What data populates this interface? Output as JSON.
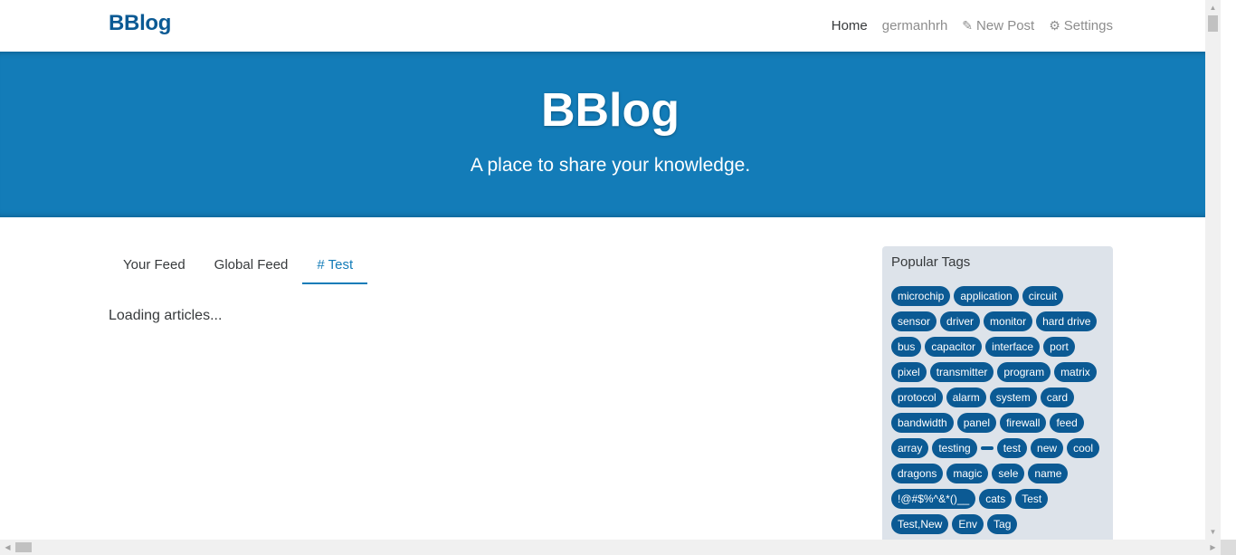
{
  "nav": {
    "brand": "BBlog",
    "links": [
      {
        "label": "Home",
        "icon": ""
      },
      {
        "label": "germanhrh",
        "icon": ""
      },
      {
        "label": "New Post",
        "icon": "✎"
      },
      {
        "label": "Settings",
        "icon": "⚙"
      }
    ]
  },
  "banner": {
    "title": "BBlog",
    "subtitle": "A place to share your knowledge."
  },
  "feed": {
    "tabs": [
      {
        "label": "Your Feed"
      },
      {
        "label": "Global Feed"
      },
      {
        "label": "# Test"
      }
    ],
    "loading_text": "Loading articles..."
  },
  "sidebar": {
    "title": "Popular Tags",
    "tags": [
      "microchip",
      "application",
      "circuit",
      "sensor",
      "driver",
      "monitor",
      "hard drive",
      "bus",
      "capacitor",
      "interface",
      "port",
      "pixel",
      "transmitter",
      "program",
      "matrix",
      "protocol",
      "alarm",
      "system",
      "card",
      "bandwidth",
      "panel",
      "firewall",
      "feed",
      "array",
      "testing",
      "",
      "test",
      "new",
      "cool",
      "dragons",
      "magic",
      "sele",
      "name",
      "!@#$%^&*()__",
      "cats",
      "Test",
      "Test,New",
      "Env",
      "Tag"
    ]
  },
  "colors": {
    "brand": "#0b5a94",
    "banner": "#137cb8",
    "tag": "#0b5a94",
    "sidebar_bg": "#dde3ea"
  }
}
